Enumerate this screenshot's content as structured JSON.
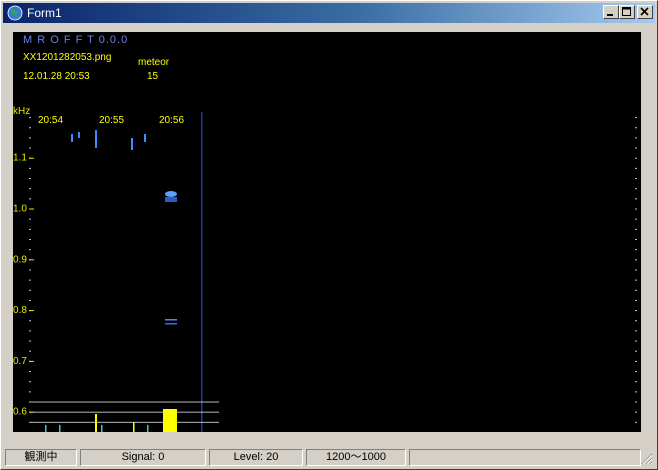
{
  "window": {
    "title": "Form1",
    "icon": "globe-icon",
    "controls": {
      "minimize": "minimize-icon",
      "maximize": "maximize-icon",
      "close": "close-icon"
    }
  },
  "overlay": {
    "program": "M R O F F T 0.0.0",
    "filename": "XX1201282053.png",
    "datetime": "12.01.28 20:53",
    "meteor_label": "meteor",
    "meteor_count": "15",
    "unit": "kHz",
    "colors": {
      "program": "#6a7ee8",
      "info": "#ffff00",
      "axis": "#e8e800"
    }
  },
  "spectrogram": {
    "time_labels": [
      "20:54",
      "20:55",
      "20:56"
    ],
    "freq_labels": [
      "1.1",
      "1.0",
      "0.9",
      "0.8",
      "0.7",
      "0.6"
    ],
    "freq_range_khz": [
      0.56,
      1.19
    ],
    "freq_major_ticks_khz": [
      1.1,
      1.0,
      0.9,
      0.8,
      0.7,
      0.6
    ],
    "reference_lines_khz": [
      0.62,
      0.6,
      0.58
    ],
    "colors": {
      "background": "#000000",
      "marker": "#1e3ca0",
      "signal": "#3a8cff",
      "level": "#ffff00",
      "cyan": "#38c8e0"
    }
  },
  "status": {
    "state": "観測中",
    "signal": "Signal: 0",
    "level": "Level: 20",
    "range": "1200～1000"
  }
}
